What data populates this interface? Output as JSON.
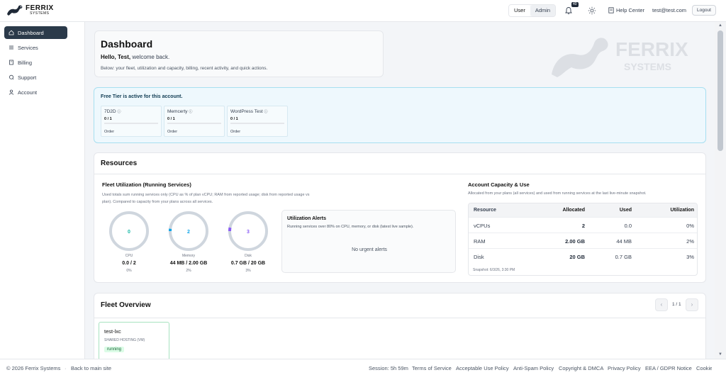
{
  "brand": {
    "name_line1": "FERRIX",
    "name_line2": "SYSTEMS"
  },
  "topbar": {
    "role_user": "User",
    "role_admin": "Admin",
    "notification_count": "40",
    "help_label": "Help Center",
    "email": "test@test.com",
    "logout_label": "Logout"
  },
  "sidebar": {
    "items": [
      {
        "label": "Dashboard",
        "icon": "home-icon"
      },
      {
        "label": "Services",
        "icon": "list-icon"
      },
      {
        "label": "Billing",
        "icon": "receipt-icon"
      },
      {
        "label": "Support",
        "icon": "chat-icon"
      },
      {
        "label": "Account",
        "icon": "user-icon"
      }
    ]
  },
  "hero": {
    "title": "Dashboard",
    "greeting_bold": "Hello, Test,",
    "greeting_rest": " welcome back.",
    "description": "Below: your fleet, utilization and capacity, billing, recent activity, and quick actions."
  },
  "watermark": {
    "line1": "FERRIX",
    "line2": "SYSTEMS"
  },
  "free_tier": {
    "title": "Free Tier is active for this account.",
    "tiles": [
      {
        "name": "7D2D",
        "count": "0 / 1",
        "order": "Order"
      },
      {
        "name": "Memcerty",
        "count": "0 / 1",
        "order": "Order"
      },
      {
        "name": "WordPress Test",
        "count": "0 / 1",
        "order": "Order"
      }
    ]
  },
  "resources": {
    "title": "Resources",
    "fleet_util": {
      "title": "Fleet Utilization (Running Services)",
      "description": "Used totals sum running services only (CPU as % of plan vCPU; RAM from reported usage; disk from reported usage vs plan). Compared to capacity from your plans across all services.",
      "rings": [
        {
          "center": "0",
          "label": "CPU",
          "value": "0.0 / 2",
          "pct": "0%",
          "fill": 0.0,
          "color": "#14b8a6"
        },
        {
          "center": "2",
          "label": "Memory",
          "value": "44 MB / 2.00 GB",
          "pct": "2%",
          "fill": 0.02,
          "color": "#0ea5e9"
        },
        {
          "center": "3",
          "label": "Disk",
          "value": "0.7 GB / 20 GB",
          "pct": "3%",
          "fill": 0.03,
          "color": "#8b5cf6"
        }
      ]
    },
    "alerts": {
      "title": "Utilization Alerts",
      "description": "Running services over 80% on CPU, memory, or disk (latest live sample).",
      "empty": "No urgent alerts"
    },
    "capacity": {
      "title": "Account Capacity & Use",
      "description": "Allocated from your plans (all services) and used from running services at the last live-minute snapshot.",
      "headers": [
        "Resource",
        "Allocated",
        "Used",
        "Utilization"
      ],
      "rows": [
        [
          "vCPUs",
          "2",
          "0.0",
          "0%"
        ],
        [
          "RAM",
          "2.00 GB",
          "44 MB",
          "2%"
        ],
        [
          "Disk",
          "20 GB",
          "0.7 GB",
          "3%"
        ]
      ],
      "snapshot": "Snapshot: 6/3/26, 3:30 PM"
    }
  },
  "fleet": {
    "title": "Fleet Overview",
    "page": "1 / 1",
    "prev": "‹",
    "next": "›",
    "service": {
      "name": "test-lxc",
      "type": "SHARED HOSTING (VM)",
      "status": "running"
    }
  },
  "footer": {
    "copyright": "© 2026 Ferrix Systems",
    "back": "Back to main site",
    "session": "Session: 5h 59m",
    "links": [
      "Terms of Service",
      "Acceptable Use Policy",
      "Anti-Spam Policy",
      "Copyright & DMCA",
      "Privacy Policy",
      "EEA / GDPR Notice",
      "Cookie Notice"
    ]
  },
  "colors": {
    "sidebar_active": "#2b3a4a",
    "free_tier_bg": "#eef8fd",
    "running_green": "#166534"
  }
}
